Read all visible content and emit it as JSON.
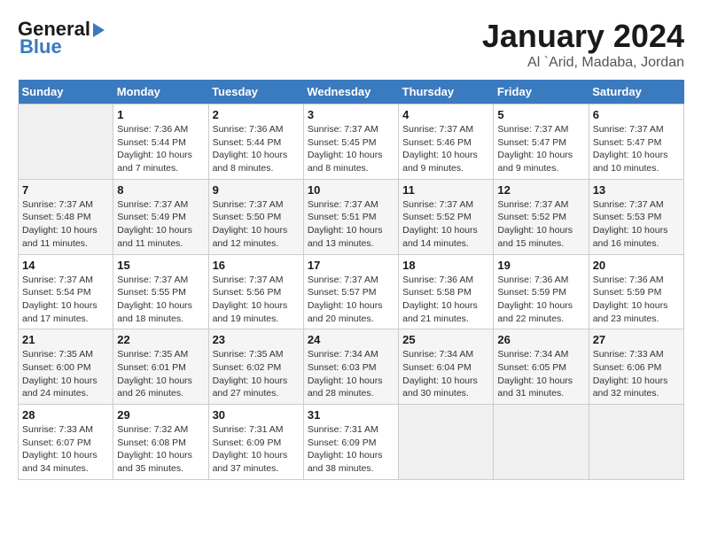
{
  "header": {
    "logo_line1": "General",
    "logo_line2": "Blue",
    "month": "January 2024",
    "location": "Al `Arid, Madaba, Jordan"
  },
  "days_of_week": [
    "Sunday",
    "Monday",
    "Tuesday",
    "Wednesday",
    "Thursday",
    "Friday",
    "Saturday"
  ],
  "weeks": [
    [
      {
        "num": "",
        "info": ""
      },
      {
        "num": "1",
        "info": "Sunrise: 7:36 AM\nSunset: 5:44 PM\nDaylight: 10 hours\nand 7 minutes."
      },
      {
        "num": "2",
        "info": "Sunrise: 7:36 AM\nSunset: 5:44 PM\nDaylight: 10 hours\nand 8 minutes."
      },
      {
        "num": "3",
        "info": "Sunrise: 7:37 AM\nSunset: 5:45 PM\nDaylight: 10 hours\nand 8 minutes."
      },
      {
        "num": "4",
        "info": "Sunrise: 7:37 AM\nSunset: 5:46 PM\nDaylight: 10 hours\nand 9 minutes."
      },
      {
        "num": "5",
        "info": "Sunrise: 7:37 AM\nSunset: 5:47 PM\nDaylight: 10 hours\nand 9 minutes."
      },
      {
        "num": "6",
        "info": "Sunrise: 7:37 AM\nSunset: 5:47 PM\nDaylight: 10 hours\nand 10 minutes."
      }
    ],
    [
      {
        "num": "7",
        "info": "Sunrise: 7:37 AM\nSunset: 5:48 PM\nDaylight: 10 hours\nand 11 minutes."
      },
      {
        "num": "8",
        "info": "Sunrise: 7:37 AM\nSunset: 5:49 PM\nDaylight: 10 hours\nand 11 minutes."
      },
      {
        "num": "9",
        "info": "Sunrise: 7:37 AM\nSunset: 5:50 PM\nDaylight: 10 hours\nand 12 minutes."
      },
      {
        "num": "10",
        "info": "Sunrise: 7:37 AM\nSunset: 5:51 PM\nDaylight: 10 hours\nand 13 minutes."
      },
      {
        "num": "11",
        "info": "Sunrise: 7:37 AM\nSunset: 5:52 PM\nDaylight: 10 hours\nand 14 minutes."
      },
      {
        "num": "12",
        "info": "Sunrise: 7:37 AM\nSunset: 5:52 PM\nDaylight: 10 hours\nand 15 minutes."
      },
      {
        "num": "13",
        "info": "Sunrise: 7:37 AM\nSunset: 5:53 PM\nDaylight: 10 hours\nand 16 minutes."
      }
    ],
    [
      {
        "num": "14",
        "info": "Sunrise: 7:37 AM\nSunset: 5:54 PM\nDaylight: 10 hours\nand 17 minutes."
      },
      {
        "num": "15",
        "info": "Sunrise: 7:37 AM\nSunset: 5:55 PM\nDaylight: 10 hours\nand 18 minutes."
      },
      {
        "num": "16",
        "info": "Sunrise: 7:37 AM\nSunset: 5:56 PM\nDaylight: 10 hours\nand 19 minutes."
      },
      {
        "num": "17",
        "info": "Sunrise: 7:37 AM\nSunset: 5:57 PM\nDaylight: 10 hours\nand 20 minutes."
      },
      {
        "num": "18",
        "info": "Sunrise: 7:36 AM\nSunset: 5:58 PM\nDaylight: 10 hours\nand 21 minutes."
      },
      {
        "num": "19",
        "info": "Sunrise: 7:36 AM\nSunset: 5:59 PM\nDaylight: 10 hours\nand 22 minutes."
      },
      {
        "num": "20",
        "info": "Sunrise: 7:36 AM\nSunset: 5:59 PM\nDaylight: 10 hours\nand 23 minutes."
      }
    ],
    [
      {
        "num": "21",
        "info": "Sunrise: 7:35 AM\nSunset: 6:00 PM\nDaylight: 10 hours\nand 24 minutes."
      },
      {
        "num": "22",
        "info": "Sunrise: 7:35 AM\nSunset: 6:01 PM\nDaylight: 10 hours\nand 26 minutes."
      },
      {
        "num": "23",
        "info": "Sunrise: 7:35 AM\nSunset: 6:02 PM\nDaylight: 10 hours\nand 27 minutes."
      },
      {
        "num": "24",
        "info": "Sunrise: 7:34 AM\nSunset: 6:03 PM\nDaylight: 10 hours\nand 28 minutes."
      },
      {
        "num": "25",
        "info": "Sunrise: 7:34 AM\nSunset: 6:04 PM\nDaylight: 10 hours\nand 30 minutes."
      },
      {
        "num": "26",
        "info": "Sunrise: 7:34 AM\nSunset: 6:05 PM\nDaylight: 10 hours\nand 31 minutes."
      },
      {
        "num": "27",
        "info": "Sunrise: 7:33 AM\nSunset: 6:06 PM\nDaylight: 10 hours\nand 32 minutes."
      }
    ],
    [
      {
        "num": "28",
        "info": "Sunrise: 7:33 AM\nSunset: 6:07 PM\nDaylight: 10 hours\nand 34 minutes."
      },
      {
        "num": "29",
        "info": "Sunrise: 7:32 AM\nSunset: 6:08 PM\nDaylight: 10 hours\nand 35 minutes."
      },
      {
        "num": "30",
        "info": "Sunrise: 7:31 AM\nSunset: 6:09 PM\nDaylight: 10 hours\nand 37 minutes."
      },
      {
        "num": "31",
        "info": "Sunrise: 7:31 AM\nSunset: 6:09 PM\nDaylight: 10 hours\nand 38 minutes."
      },
      {
        "num": "",
        "info": ""
      },
      {
        "num": "",
        "info": ""
      },
      {
        "num": "",
        "info": ""
      }
    ]
  ]
}
